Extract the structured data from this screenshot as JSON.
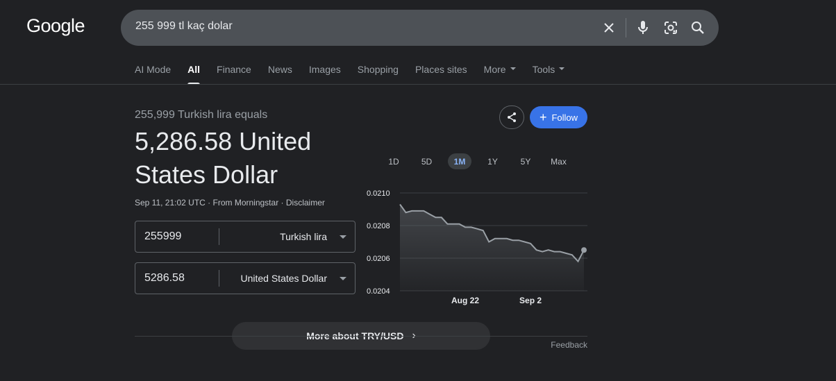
{
  "logo": "Google",
  "search": {
    "query": "255 999 tl kaç dolar"
  },
  "tabs": [
    {
      "label": "AI Mode",
      "active": false,
      "caret": false
    },
    {
      "label": "All",
      "active": true,
      "caret": false
    },
    {
      "label": "Finance",
      "active": false,
      "caret": false
    },
    {
      "label": "News",
      "active": false,
      "caret": false
    },
    {
      "label": "Images",
      "active": false,
      "caret": false
    },
    {
      "label": "Shopping",
      "active": false,
      "caret": false
    },
    {
      "label": "Places sites",
      "active": false,
      "caret": false
    },
    {
      "label": "More",
      "active": false,
      "caret": true
    },
    {
      "label": "Tools",
      "active": false,
      "caret": true
    }
  ],
  "converter": {
    "equals_label": "255,999 Turkish lira equals",
    "result": "5,286.58 United States Dollar",
    "meta_time": "Sep 11, 21:02 UTC · From Morningstar · ",
    "meta_disclaimer": "Disclaimer",
    "from": {
      "amount": "255999",
      "currency": "Turkish lira"
    },
    "to": {
      "amount": "5286.58",
      "currency": "United States Dollar"
    }
  },
  "actions": {
    "follow_label": "Follow"
  },
  "ranges": [
    {
      "label": "1D",
      "active": false
    },
    {
      "label": "5D",
      "active": false
    },
    {
      "label": "1M",
      "active": true
    },
    {
      "label": "1Y",
      "active": false
    },
    {
      "label": "5Y",
      "active": false
    },
    {
      "label": "Max",
      "active": false
    }
  ],
  "more_label": "More about TRY/USD",
  "feedback_label": "Feedback",
  "colors": {
    "accent": "#3873e7",
    "line": "#9aa0a6",
    "background": "#202124"
  },
  "chart_data": {
    "type": "area",
    "x": [
      "Aug 11",
      "Aug 12",
      "Aug 13",
      "Aug 14",
      "Aug 15",
      "Aug 16",
      "Aug 17",
      "Aug 18",
      "Aug 19",
      "Aug 20",
      "Aug 21",
      "Aug 22",
      "Aug 23",
      "Aug 24",
      "Aug 25",
      "Aug 26",
      "Aug 27",
      "Aug 28",
      "Aug 29",
      "Aug 30",
      "Aug 31",
      "Sep 1",
      "Sep 2",
      "Sep 3",
      "Sep 4",
      "Sep 5",
      "Sep 6",
      "Sep 7",
      "Sep 8",
      "Sep 9",
      "Sep 10",
      "Sep 11"
    ],
    "series": [
      {
        "values": [
          0.02093,
          0.02088,
          0.02089,
          0.02089,
          0.02089,
          0.02087,
          0.02085,
          0.02085,
          0.02081,
          0.02081,
          0.02081,
          0.02079,
          0.02079,
          0.02078,
          0.02077,
          0.0207,
          0.02072,
          0.02072,
          0.02072,
          0.02071,
          0.02071,
          0.0207,
          0.02069,
          0.02065,
          0.02064,
          0.02065,
          0.02064,
          0.02064,
          0.02063,
          0.02062,
          0.02058,
          0.02065
        ]
      }
    ],
    "xticks": [
      "Aug 22",
      "Sep 2"
    ],
    "yticks": [
      "0.0204",
      "0.0206",
      "0.0208",
      "0.0210"
    ],
    "ylim": [
      0.0204,
      0.021
    ],
    "grid": true
  }
}
